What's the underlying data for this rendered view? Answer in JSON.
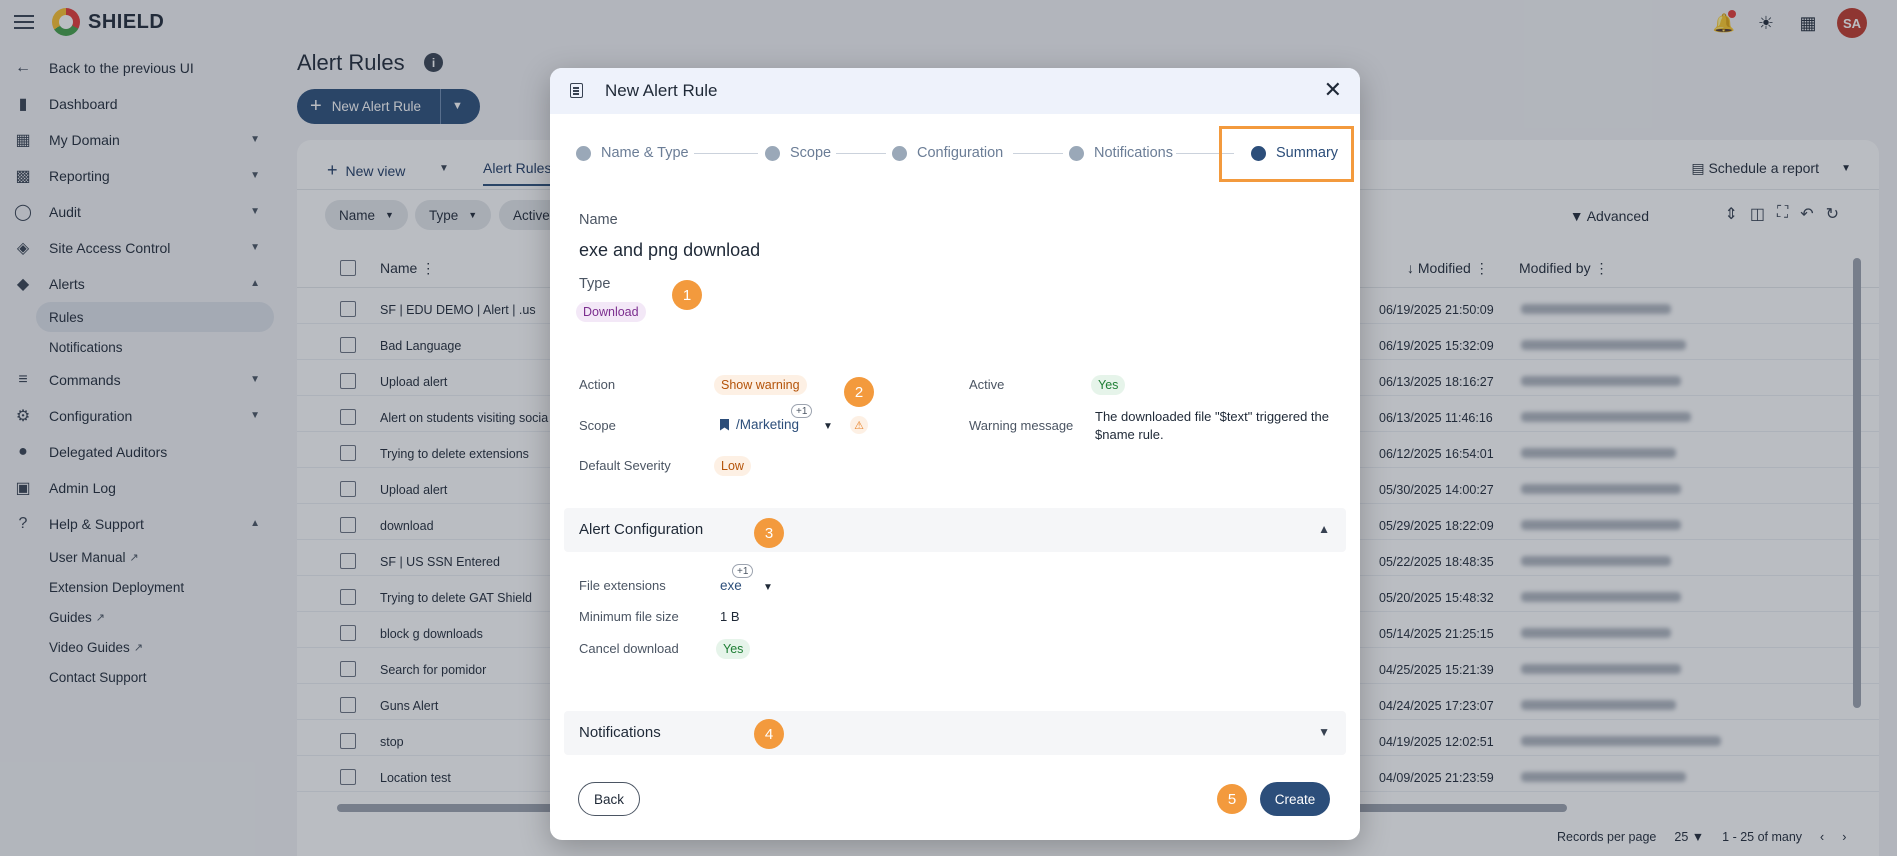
{
  "app": {
    "brand": "SHIELD",
    "avatar_initials": "SA"
  },
  "sidebar": {
    "back": "Back to the previous UI",
    "items": [
      {
        "label": "Dashboard"
      },
      {
        "label": "My Domain"
      },
      {
        "label": "Reporting"
      },
      {
        "label": "Audit"
      },
      {
        "label": "Site Access Control"
      },
      {
        "label": "Alerts"
      },
      {
        "label": "Commands"
      },
      {
        "label": "Configuration"
      },
      {
        "label": "Delegated Auditors"
      },
      {
        "label": "Admin Log"
      },
      {
        "label": "Help & Support"
      }
    ],
    "alerts_sub": [
      "Rules",
      "Notifications"
    ],
    "help_sub": [
      "User Manual",
      "Extension Deployment",
      "Guides",
      "Video Guides",
      "Contact Support"
    ]
  },
  "page": {
    "title": "Alert Rules",
    "new_button": "New Alert Rule"
  },
  "tabs": {
    "new_view": "New view",
    "active_tab": "Alert Rules",
    "schedule": "Schedule a report"
  },
  "filters": [
    "Name",
    "Type",
    "Active"
  ],
  "toolbar": {
    "advanced": "Advanced"
  },
  "table": {
    "headers": {
      "name": "Name",
      "modified": "Modified",
      "modified_by": "Modified by"
    },
    "rows": [
      {
        "name": "SF | EDU DEMO | Alert | .us",
        "modified": "06/19/2025 21:50:09"
      },
      {
        "name": "Bad Language",
        "modified": "06/19/2025 15:32:09"
      },
      {
        "name": "Upload alert",
        "modified": "06/13/2025 18:16:27"
      },
      {
        "name": "Alert on students visiting socia",
        "modified": "06/13/2025 11:46:16"
      },
      {
        "name": "Trying to delete extensions",
        "modified": "06/12/2025 16:54:01"
      },
      {
        "name": "Upload alert",
        "modified": "05/30/2025 14:00:27"
      },
      {
        "name": "download",
        "modified": "05/29/2025 18:22:09"
      },
      {
        "name": "SF | US SSN Entered",
        "modified": "05/22/2025 18:48:35"
      },
      {
        "name": "Trying to delete GAT Shield",
        "modified": "05/20/2025 15:48:32"
      },
      {
        "name": "block g downloads",
        "modified": "05/14/2025 21:25:15"
      },
      {
        "name": "Search for pomidor",
        "modified": "04/25/2025 15:21:39"
      },
      {
        "name": "Guns Alert",
        "modified": "04/24/2025 17:23:07"
      },
      {
        "name": "stop",
        "modified": "04/19/2025 12:02:51"
      },
      {
        "name": "Location test",
        "modified": "04/09/2025 21:23:59"
      }
    ]
  },
  "pagination": {
    "records_label": "Records per page",
    "per_page": "25",
    "range": "1 - 25 of many"
  },
  "modal": {
    "title": "New Alert Rule",
    "steps": [
      "Name & Type",
      "Scope",
      "Configuration",
      "Notifications",
      "Summary"
    ],
    "name_label": "Name",
    "name_value": "exe and png download",
    "type_label": "Type",
    "type_value": "Download",
    "action_label": "Action",
    "action_value": "Show warning",
    "active_label": "Active",
    "active_value": "Yes",
    "scope_label": "Scope",
    "scope_value": "/Marketing",
    "scope_more": "+1",
    "warning_label": "Warning message",
    "warning_value": "The downloaded file \"$text\" triggered the $name rule.",
    "severity_label": "Default Severity",
    "severity_value": "Low",
    "alert_config_title": "Alert Configuration",
    "file_ext_label": "File extensions",
    "file_ext_value": "exe",
    "file_ext_more": "+1",
    "min_size_label": "Minimum file size",
    "min_size_value": "1 B",
    "cancel_label": "Cancel download",
    "cancel_value": "Yes",
    "notifications_title": "Notifications",
    "back": "Back",
    "create": "Create"
  },
  "annotations": [
    "1",
    "2",
    "3",
    "4",
    "5"
  ],
  "colors": {
    "primary": "#2c4e7a",
    "annotation": "#f39a3d"
  }
}
